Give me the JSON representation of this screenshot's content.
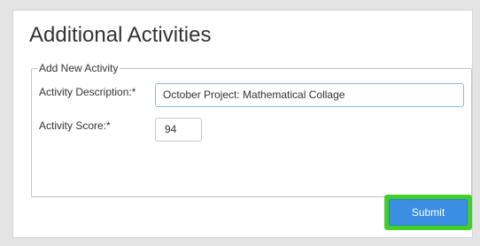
{
  "panel": {
    "title": "Additional Activities"
  },
  "form": {
    "legend": "Add New Activity",
    "description": {
      "label": "Activity Description:*",
      "value": "October Project: Mathematical Collage"
    },
    "score": {
      "label": "Activity Score:*",
      "value": "94"
    },
    "submit_label": "Submit"
  },
  "colors": {
    "submit_button": "#3b8ee2",
    "highlight_border": "#3fcf27",
    "focused_input_border": "#8fb7e3"
  }
}
